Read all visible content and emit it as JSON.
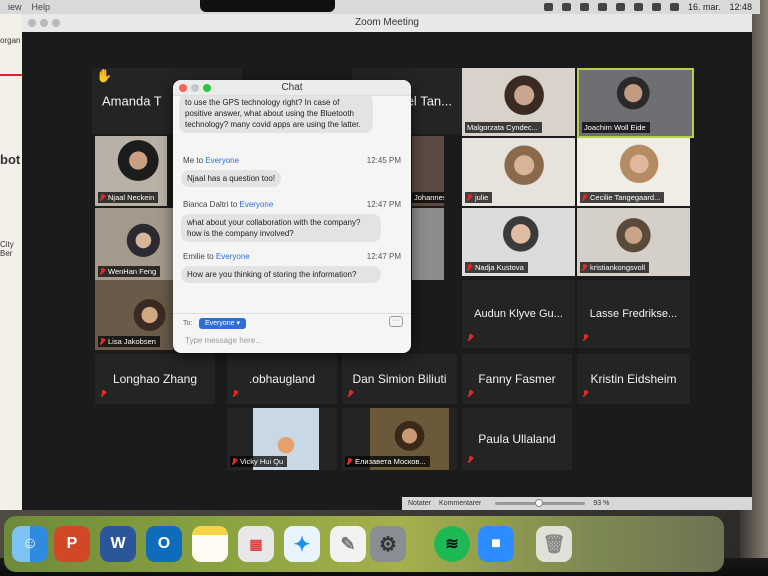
{
  "menubar": {
    "left_items": [
      "iew",
      "Help"
    ],
    "date": "16. mar.",
    "time": "12:48"
  },
  "background_app": {
    "text_1": "organ",
    "text_2": "bot",
    "text_3": "City Ber"
  },
  "window": {
    "title": "Zoom Meeting"
  },
  "participants": [
    {
      "name": "Amanda T",
      "muted": false,
      "raised_hand": true
    },
    {
      "name": "Daniel Tan...",
      "muted": false
    },
    {
      "name": "Malgorzata Cyndec...",
      "muted": true
    },
    {
      "name": "Joachim Woll Eide",
      "muted": false,
      "active_speaker": true
    },
    {
      "name": "Njaal Neckein",
      "muted": true
    },
    {
      "name": "Johannes",
      "muted": true
    },
    {
      "name": "julie",
      "muted": true
    },
    {
      "name": "Cecilie Tangegaard...",
      "muted": true
    },
    {
      "name": "WenHan Feng",
      "muted": true
    },
    {
      "name": "Nadja Kustova",
      "muted": true
    },
    {
      "name": "kristiankongsvoll",
      "muted": true
    },
    {
      "name": "Lisa Jakobsen",
      "muted": true
    },
    {
      "name": "Audun Klyve Gu...",
      "muted": true
    },
    {
      "name": "Lasse Fredrikse...",
      "muted": true
    },
    {
      "name": "Longhao Zhang",
      "muted": true
    },
    {
      "name": ".obhaugland",
      "muted": true
    },
    {
      "name": "Dan Simion Biliuti",
      "muted": true
    },
    {
      "name": "Fanny Fasmer",
      "muted": true
    },
    {
      "name": "Kristin Eidsheim",
      "muted": true
    },
    {
      "name": "Vicky Hui Qu",
      "muted": true
    },
    {
      "name": "Елизавета Москов...",
      "muted": true
    },
    {
      "name": "Paula Ullaland",
      "muted": true
    }
  ],
  "chat": {
    "title": "Chat",
    "messages": [
      {
        "text": "to use the GPS technology right? In case of positive answer, what about using the Bluetooth technology? many covid apps are using the latter."
      },
      {
        "from": "Me",
        "to_word": "to",
        "to": "Everyone",
        "time": "12:45 PM",
        "text": "Njaal has a question too!"
      },
      {
        "from": "Bianca Daltri",
        "to_word": "to",
        "to": "Everyone",
        "time": "12:47 PM",
        "text": "what about your collaboration with the company? how is the company involved?"
      },
      {
        "from": "Emilie",
        "to_word": "to",
        "to": "Everyone",
        "time": "12:47 PM",
        "text": "How are you thinking of storing the information?"
      }
    ],
    "to_label": "To:",
    "recipient": "Everyone",
    "more": "···",
    "placeholder": "Type message here..."
  },
  "bottom_bar": {
    "notes": "Notater",
    "comments": "Kommentarer",
    "zoom_percent": "93 %"
  },
  "dock_apps": [
    "Finder",
    "PowerPoint",
    "Word",
    "Outlook",
    "Notes",
    "Launchpad",
    "Safari",
    "Script Editor",
    "System Preferences",
    "Spotify",
    "Zoom",
    "Trash"
  ],
  "colors": {
    "active_speaker_border": "#b6cf48",
    "muted_icon": "#e02a2a",
    "chat_link": "#2d6fd6"
  }
}
